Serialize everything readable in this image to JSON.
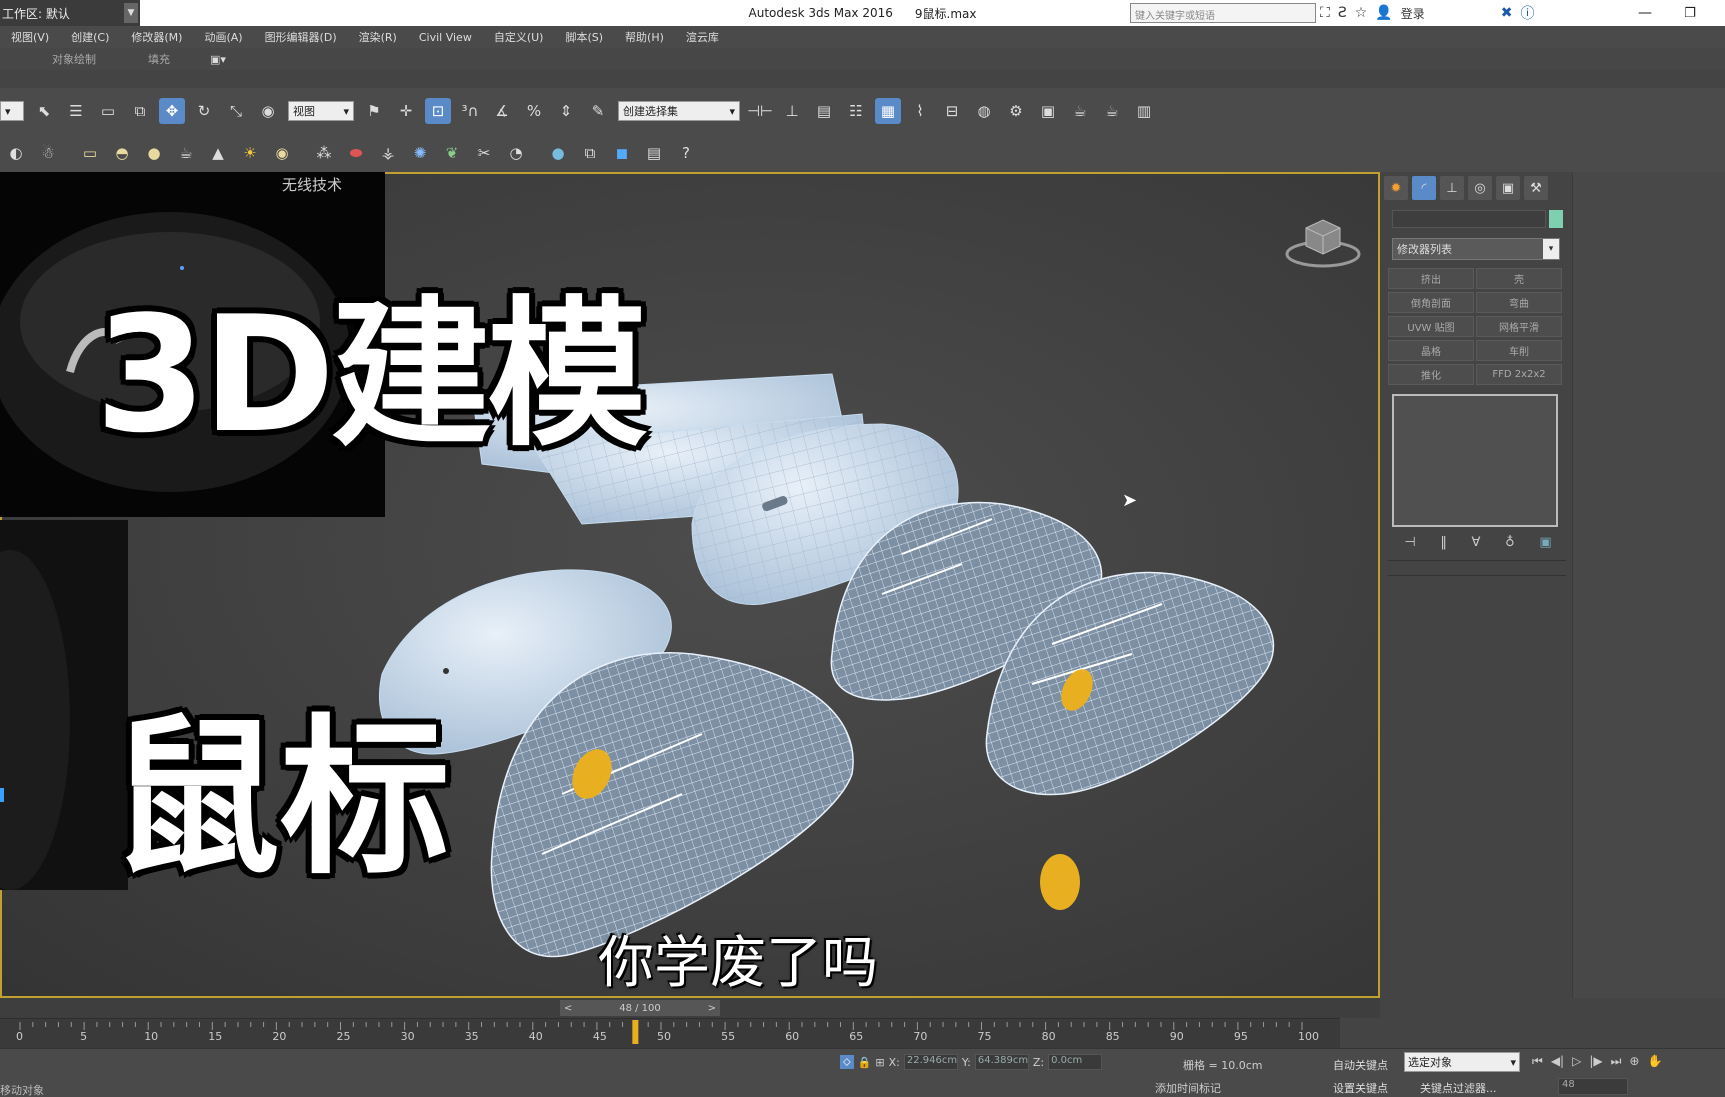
{
  "window": {
    "workspace_label": "工作区: 默认",
    "app_title": "Autodesk 3ds Max 2016",
    "file_name": "9鼠标.max",
    "search_placeholder": "键入关键字或短语",
    "login_label": "登录",
    "min_glyph": "—",
    "restore_glyph": "❐"
  },
  "menu": {
    "items": [
      "视图(V)",
      "创建(C)",
      "修改器(M)",
      "动画(A)",
      "图形编辑器(D)",
      "渲染(R)",
      "Civil View",
      "自定义(U)",
      "脚本(S)",
      "帮助(H)",
      "渲云库"
    ]
  },
  "ribbon": {
    "object_paint": "对象绘制",
    "fill": "填充"
  },
  "toolbar": {
    "view_dropdown": "视图",
    "selection_set": "创建选择集"
  },
  "viewport": {
    "reference_label": "无线技术",
    "overlay_line1": "3D建模",
    "overlay_line2": "鼠标",
    "subtitle": "你学废了吗"
  },
  "command_panel": {
    "modifier_list": "修改器列表",
    "modifier_buttons": [
      "挤出",
      "壳",
      "倒角剖面",
      "弯曲",
      "UVW 贴图",
      "网格平滑",
      "晶格",
      "车削",
      "推化",
      "FFD 2x2x2"
    ]
  },
  "timeline": {
    "position": "48 / 100",
    "current_frame": 48,
    "ticks": [
      "0",
      "5",
      "10",
      "15",
      "20",
      "25",
      "30",
      "35",
      "40",
      "45",
      "50",
      "55",
      "60",
      "65",
      "70",
      "75",
      "80",
      "85",
      "90",
      "95",
      "100"
    ]
  },
  "status": {
    "left_text": "移动对象",
    "x_label": "X:",
    "x_value": "22.946cm",
    "y_label": "Y:",
    "y_value": "64.389cm",
    "z_label": "Z:",
    "z_value": "0.0cm",
    "grid": "栅格 = 10.0cm",
    "add_time_tag": "添加时间标记",
    "auto_key": "自动关键点",
    "set_key": "设置关键点",
    "selected_object": "选定对象",
    "key_filter": "关键点过滤器...",
    "frame_input": "48"
  },
  "colors": {
    "viewport_border": "#c2a030",
    "active_tool": "#5a8ac8",
    "wireframe": "#c7dcef",
    "mouse_wheel": "#e8b020",
    "object_color": "#7fd0b0"
  }
}
